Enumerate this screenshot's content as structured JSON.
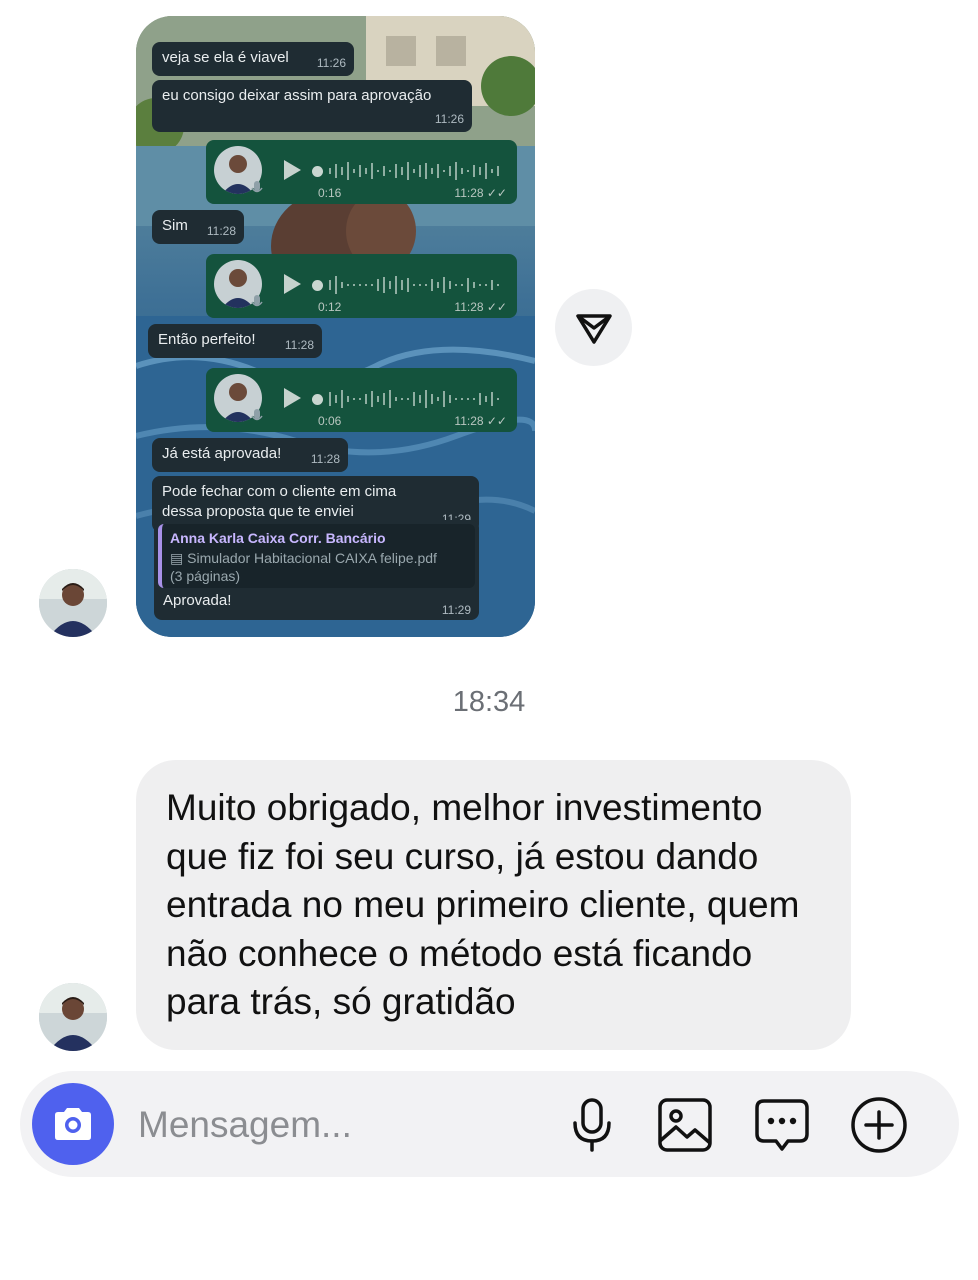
{
  "shared_screenshot": {
    "messages": [
      {
        "type": "text",
        "text": "veja se ela é viavel",
        "time": "11:26"
      },
      {
        "type": "text",
        "text": "eu consigo deixar assim para aprovação",
        "time": "11:26"
      },
      {
        "type": "audio",
        "duration": "0:16",
        "time": "11:28"
      },
      {
        "type": "text",
        "text": "Sim",
        "time": "11:28"
      },
      {
        "type": "audio",
        "duration": "0:12",
        "time": "11:28"
      },
      {
        "type": "text",
        "text": "Então perfeito!",
        "time": "11:28"
      },
      {
        "type": "audio",
        "duration": "0:06",
        "time": "11:28"
      },
      {
        "type": "text",
        "text": "Já está aprovada!",
        "time": "11:28"
      },
      {
        "type": "text",
        "text": "Pode fechar com o cliente em cima dessa proposta que te enviei",
        "time": "11:29"
      }
    ],
    "reply": {
      "quoted_name": "Anna Karla Caixa Corr. Bancário",
      "quoted_file": "Simulador Habitacional CAIXA felipe.pdf",
      "quoted_pages": "(3 páginas)",
      "text": "Aprovada!",
      "time": "11:29"
    },
    "colors": {
      "incoming": "#1f2c33",
      "outgoing_audio": "#14533d",
      "quote_accent": "#a891e8"
    }
  },
  "timestamp": "18:34",
  "message": {
    "text": "Muito obrigado, melhor investimento que fiz foi seu curso, já estou dando entrada no meu primeiro cliente, quem não conhece o método está ficando para trás, só gratidão"
  },
  "composer": {
    "placeholder": "Mensagem...",
    "icons": [
      "camera-icon",
      "microphone-icon",
      "image-icon",
      "chat-bubble-icon",
      "plus-circle-icon"
    ],
    "accent": "#4f61ee"
  }
}
